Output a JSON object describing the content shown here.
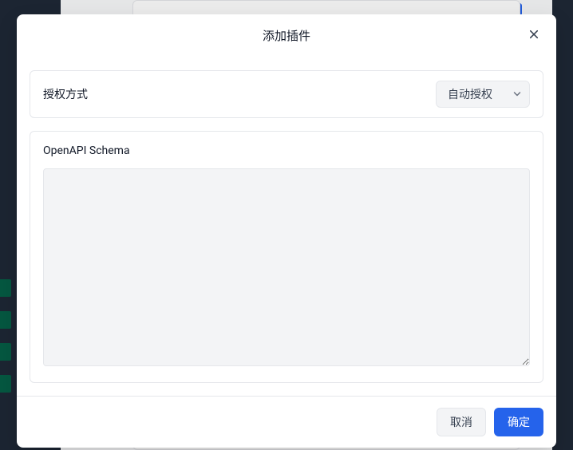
{
  "modal": {
    "title": "添加插件",
    "auth_label": "授权方式",
    "auth_select_value": "自动授权",
    "schema_label": "OpenAPI Schema",
    "schema_value": "",
    "cancel_label": "取消",
    "confirm_label": "确定"
  }
}
